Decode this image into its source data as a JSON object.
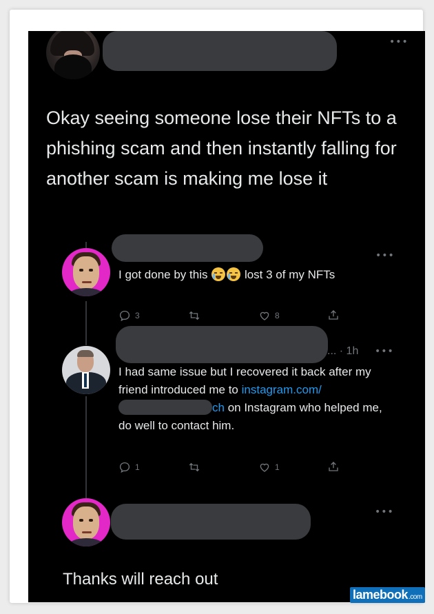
{
  "tweet": {
    "text": "Okay seeing someone lose their NFTs to a phishing scam and then instantly falling for another scam is making me lose it",
    "menu": "•••"
  },
  "reply1": {
    "text_before": "I got done by this",
    "text_after": "lost 3 of my NFTs",
    "emoji": "crying-face-emoji",
    "menu": "•••",
    "actions": {
      "replies": "3",
      "retweets": "",
      "likes": "8"
    }
  },
  "reply2": {
    "time": "... · 1h",
    "text_line1": "I had same issue  but I recovered it back after my friend introduced me to",
    "link_start": "instagram.com/",
    "link_end": "ch",
    "text_after_link": "on Instagram who helped me, do well to contact him.",
    "menu": "•••",
    "actions": {
      "replies": "1",
      "retweets": "",
      "likes": "1"
    }
  },
  "reply3": {
    "text": "Thanks will reach out",
    "menu": "•••"
  },
  "watermark": {
    "name": "lamebook",
    "suffix": ".com"
  },
  "colors": {
    "background": "#000000",
    "text": "#e7e9ea",
    "muted": "#71767b",
    "link": "#1d9bf0",
    "redaction": "#3a3b3e"
  }
}
